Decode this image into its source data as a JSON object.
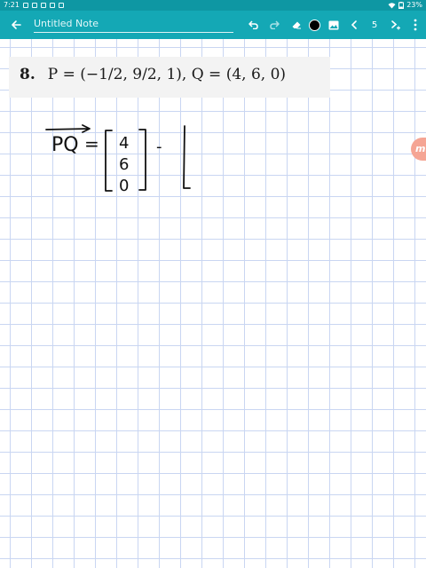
{
  "status_bar": {
    "time": "7:21",
    "battery": "23%"
  },
  "toolbar": {
    "title": "Untitled Note",
    "page_number": "5",
    "icons": {
      "back": "arrow-left-icon",
      "undo": "undo-icon",
      "redo": "redo-icon",
      "eraser": "eraser-icon",
      "pen_color": "color-dot-icon",
      "image": "image-icon",
      "prev": "chevron-left-icon",
      "next": "chevron-right-icon",
      "add_page": "add-page-icon",
      "menu": "more-vertical-icon"
    }
  },
  "colors": {
    "toolbar": "#14a8b5",
    "status_bar": "#0e97a3",
    "grid": "#c9d6f2",
    "pen": "#000000",
    "side_tab": "#f5a594"
  },
  "problem": {
    "number": "8.",
    "expression": "P = (−1/2, 9/2, 1),   Q = (4, 6, 0)"
  },
  "handwriting": {
    "vector_label": "PQ",
    "equals": "=",
    "entries": [
      "4",
      "6",
      "0"
    ],
    "minus": "-"
  },
  "side_tab": {
    "label": "m"
  }
}
